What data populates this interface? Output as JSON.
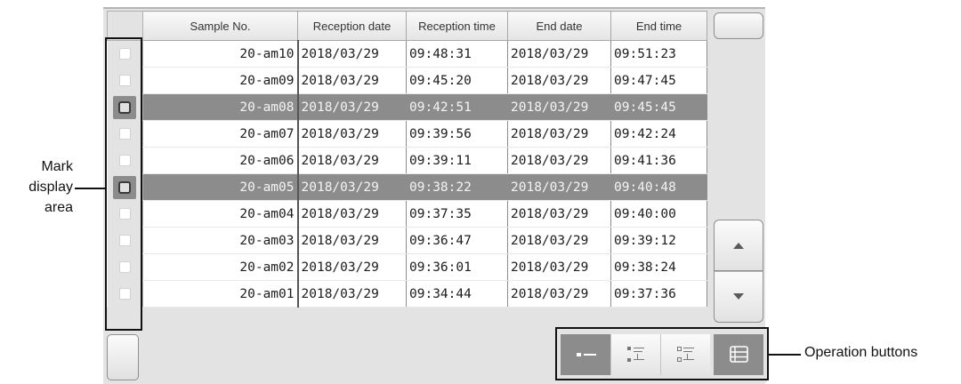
{
  "table": {
    "headers": [
      "Sample No.",
      "Reception date",
      "Reception time",
      "End date",
      "End time"
    ],
    "rows": [
      {
        "sample": "20-am10",
        "rec_date": "2018/03/29",
        "rec_time": "09:48:31",
        "end_date": "2018/03/29",
        "end_time": "09:51:23",
        "selected": false
      },
      {
        "sample": "20-am09",
        "rec_date": "2018/03/29",
        "rec_time": "09:45:20",
        "end_date": "2018/03/29",
        "end_time": "09:47:45",
        "selected": false
      },
      {
        "sample": "20-am08",
        "rec_date": "2018/03/29",
        "rec_time": "09:42:51",
        "end_date": "2018/03/29",
        "end_time": "09:45:45",
        "selected": true
      },
      {
        "sample": "20-am07",
        "rec_date": "2018/03/29",
        "rec_time": "09:39:56",
        "end_date": "2018/03/29",
        "end_time": "09:42:24",
        "selected": false
      },
      {
        "sample": "20-am06",
        "rec_date": "2018/03/29",
        "rec_time": "09:39:11",
        "end_date": "2018/03/29",
        "end_time": "09:41:36",
        "selected": false
      },
      {
        "sample": "20-am05",
        "rec_date": "2018/03/29",
        "rec_time": "09:38:22",
        "end_date": "2018/03/29",
        "end_time": "09:40:48",
        "selected": true
      },
      {
        "sample": "20-am04",
        "rec_date": "2018/03/29",
        "rec_time": "09:37:35",
        "end_date": "2018/03/29",
        "end_time": "09:40:00",
        "selected": false
      },
      {
        "sample": "20-am03",
        "rec_date": "2018/03/29",
        "rec_time": "09:36:47",
        "end_date": "2018/03/29",
        "end_time": "09:39:12",
        "selected": false
      },
      {
        "sample": "20-am02",
        "rec_date": "2018/03/29",
        "rec_time": "09:36:01",
        "end_date": "2018/03/29",
        "end_time": "09:38:24",
        "selected": false
      },
      {
        "sample": "20-am01",
        "rec_date": "2018/03/29",
        "rec_time": "09:34:44",
        "end_date": "2018/03/29",
        "end_time": "09:37:36",
        "selected": false
      }
    ]
  },
  "scroll": {
    "up_icon": "triangle-up-icon",
    "down_icon": "triangle-down-icon"
  },
  "operation_buttons": [
    {
      "icon": "single-line-view-icon",
      "active": true
    },
    {
      "icon": "list-detail-view-icon",
      "active": false
    },
    {
      "icon": "list-outline-view-icon",
      "active": false
    },
    {
      "icon": "table-view-icon",
      "active": true
    }
  ],
  "annotations": {
    "mark_display_area": "Mark\ndisplay\narea",
    "operation_buttons": "Operation buttons"
  },
  "colors": {
    "selected_row": "#8c8c8c",
    "panel": "#e3e3e3",
    "annotation": "#111111"
  }
}
